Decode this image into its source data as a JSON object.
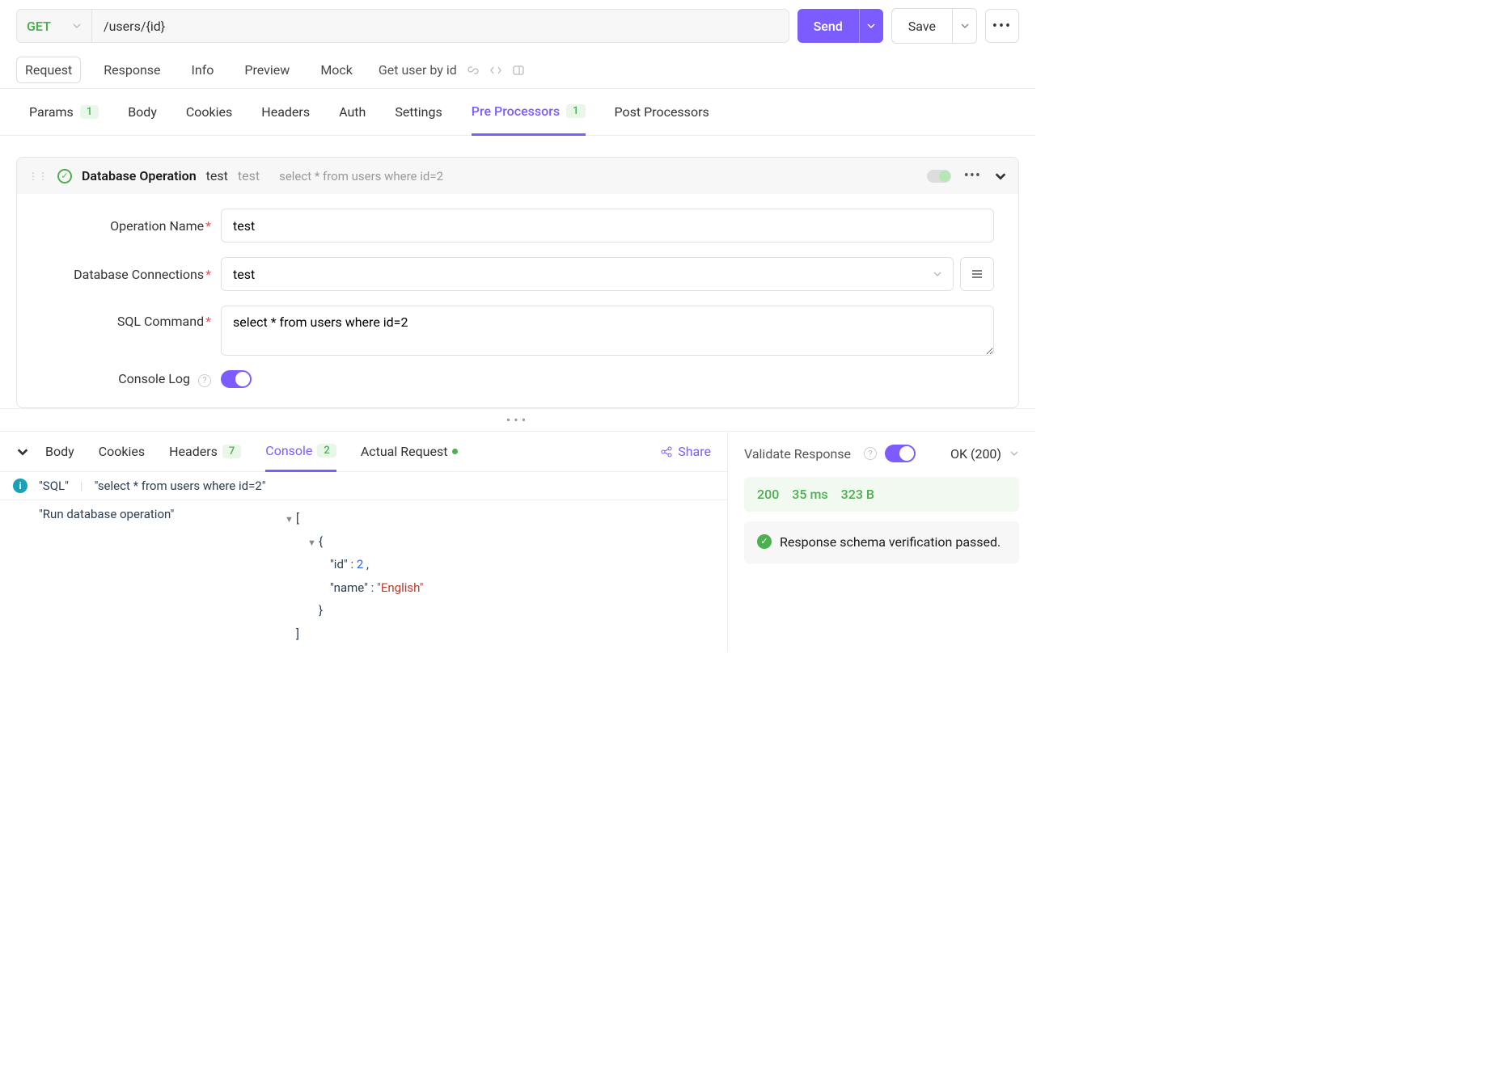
{
  "topbar": {
    "method": "GET",
    "url": "/users/{id}",
    "send": "Send",
    "save": "Save"
  },
  "req_tabs": [
    "Request",
    "Response",
    "Info",
    "Preview",
    "Mock"
  ],
  "doc_title": "Get user by id",
  "sub_tabs": {
    "params": "Params",
    "params_badge": "1",
    "body": "Body",
    "cookies": "Cookies",
    "headers": "Headers",
    "auth": "Auth",
    "settings": "Settings",
    "pre": "Pre Processors",
    "pre_badge": "1",
    "post": "Post Processors"
  },
  "processor": {
    "title": "Database Operation",
    "name": "test",
    "name2": "test",
    "desc": "select * from users where id=2",
    "form": {
      "operation_name_label": "Operation Name",
      "operation_name_value": "test",
      "db_conn_label": "Database Connections",
      "db_conn_value": "test",
      "sql_label": "SQL Command",
      "sql_value": "select * from users where id=2",
      "console_log_label": "Console Log"
    }
  },
  "resp_tabs": {
    "body": "Body",
    "cookies": "Cookies",
    "headers": "Headers",
    "headers_badge": "7",
    "console": "Console",
    "console_badge": "2",
    "actual": "Actual Request",
    "share": "Share"
  },
  "console": {
    "tag": "\"SQL\"",
    "sql": "\"select * from users where id=2\"",
    "run_msg": "\"Run database operation\"",
    "json": {
      "id_key": "\"id\"",
      "id_val": "2",
      "name_key": "\"name\"",
      "name_val": "\"English\""
    }
  },
  "validate": {
    "label": "Validate Response",
    "status_text": "OK (200)",
    "code": "200",
    "time": "35 ms",
    "size": "323 B",
    "schema_msg": "Response schema verification passed."
  }
}
